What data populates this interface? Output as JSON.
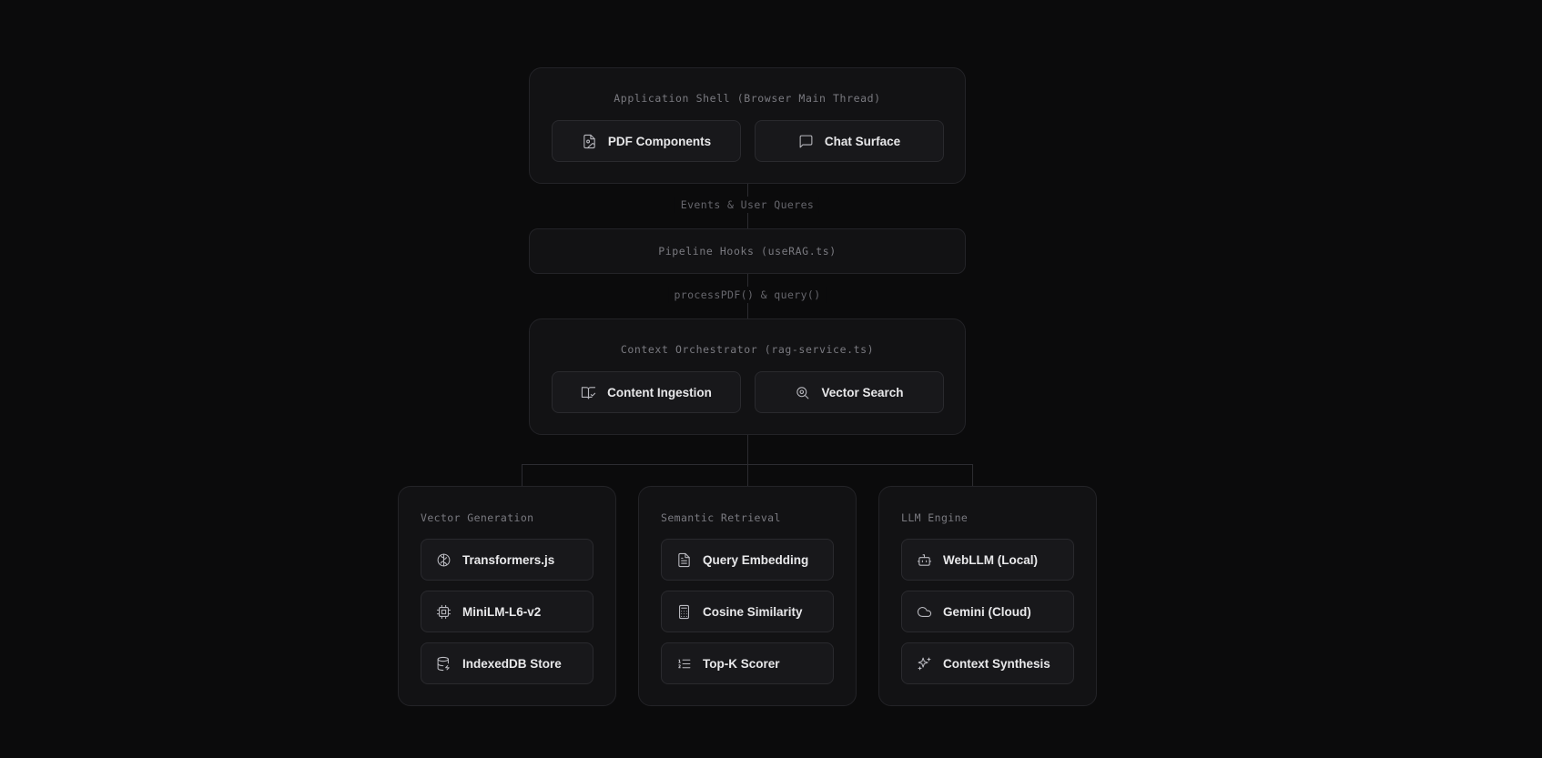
{
  "shell": {
    "title": "Application Shell (Browser Main Thread)",
    "items": [
      {
        "label": "PDF Components",
        "icon": "file-image-icon"
      },
      {
        "label": "Chat Surface",
        "icon": "message-square-icon"
      }
    ]
  },
  "edge1": {
    "label": "Events & User Queres"
  },
  "hooks": {
    "title": "Pipeline Hooks (useRAG.ts)"
  },
  "edge2": {
    "label": "processPDF() & query()"
  },
  "orchestrator": {
    "title": "Context Orchestrator (rag-service.ts)",
    "items": [
      {
        "label": "Content Ingestion",
        "icon": "book-check-icon"
      },
      {
        "label": "Vector Search",
        "icon": "search-zoom-icon"
      }
    ]
  },
  "columns": [
    {
      "title": "Vector Generation",
      "items": [
        {
          "label": "Transformers.js",
          "icon": "brain-icon"
        },
        {
          "label": "MiniLM-L6-v2",
          "icon": "cpu-icon"
        },
        {
          "label": "IndexedDB Store",
          "icon": "database-icon"
        }
      ]
    },
    {
      "title": "Semantic Retrieval",
      "items": [
        {
          "label": "Query Embedding",
          "icon": "file-text-icon"
        },
        {
          "label": "Cosine Similarity",
          "icon": "calculator-icon"
        },
        {
          "label": "Top-K Scorer",
          "icon": "list-ordered-icon"
        }
      ]
    },
    {
      "title": "LLM Engine",
      "items": [
        {
          "label": "WebLLM (Local)",
          "icon": "bot-icon"
        },
        {
          "label": "Gemini (Cloud)",
          "icon": "cloud-icon"
        },
        {
          "label": "Context Synthesis",
          "icon": "sparkles-icon"
        }
      ]
    }
  ]
}
